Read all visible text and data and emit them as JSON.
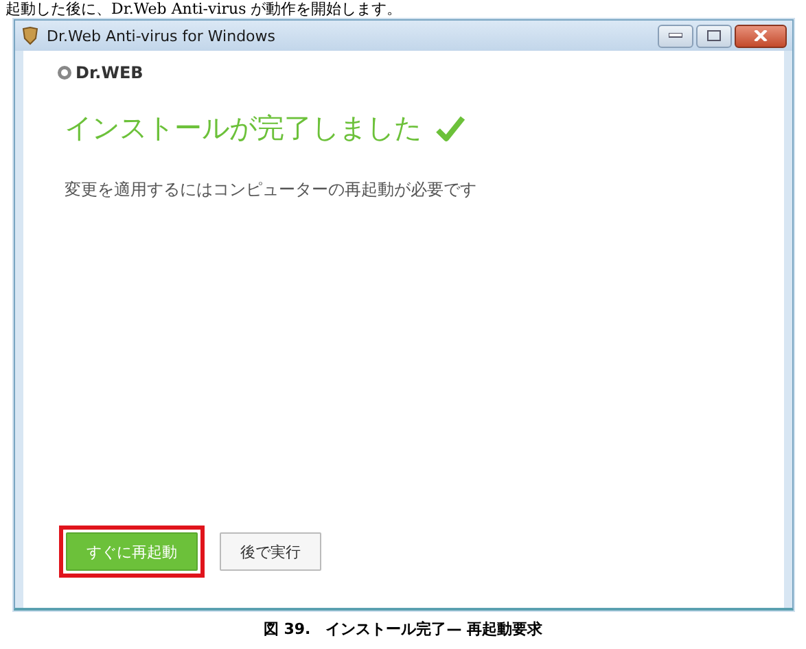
{
  "doc_text": "起動した後に、Dr.Web Anti-virus が動作を開始します。",
  "window": {
    "title": "Dr.Web Anti-virus for Windows"
  },
  "logo": "Dr.WEB",
  "heading": "インストールが完了しました",
  "message": "変更を適用するにはコンピューターの再起動が必要です",
  "buttons": [
    {
      "label": "すぐに再起動",
      "kind": "primary",
      "highlighted": true
    },
    {
      "label": "後で実行",
      "kind": "secondary",
      "highlighted": false
    }
  ],
  "caption": "図 39.　インストール完了— 再起動要求"
}
